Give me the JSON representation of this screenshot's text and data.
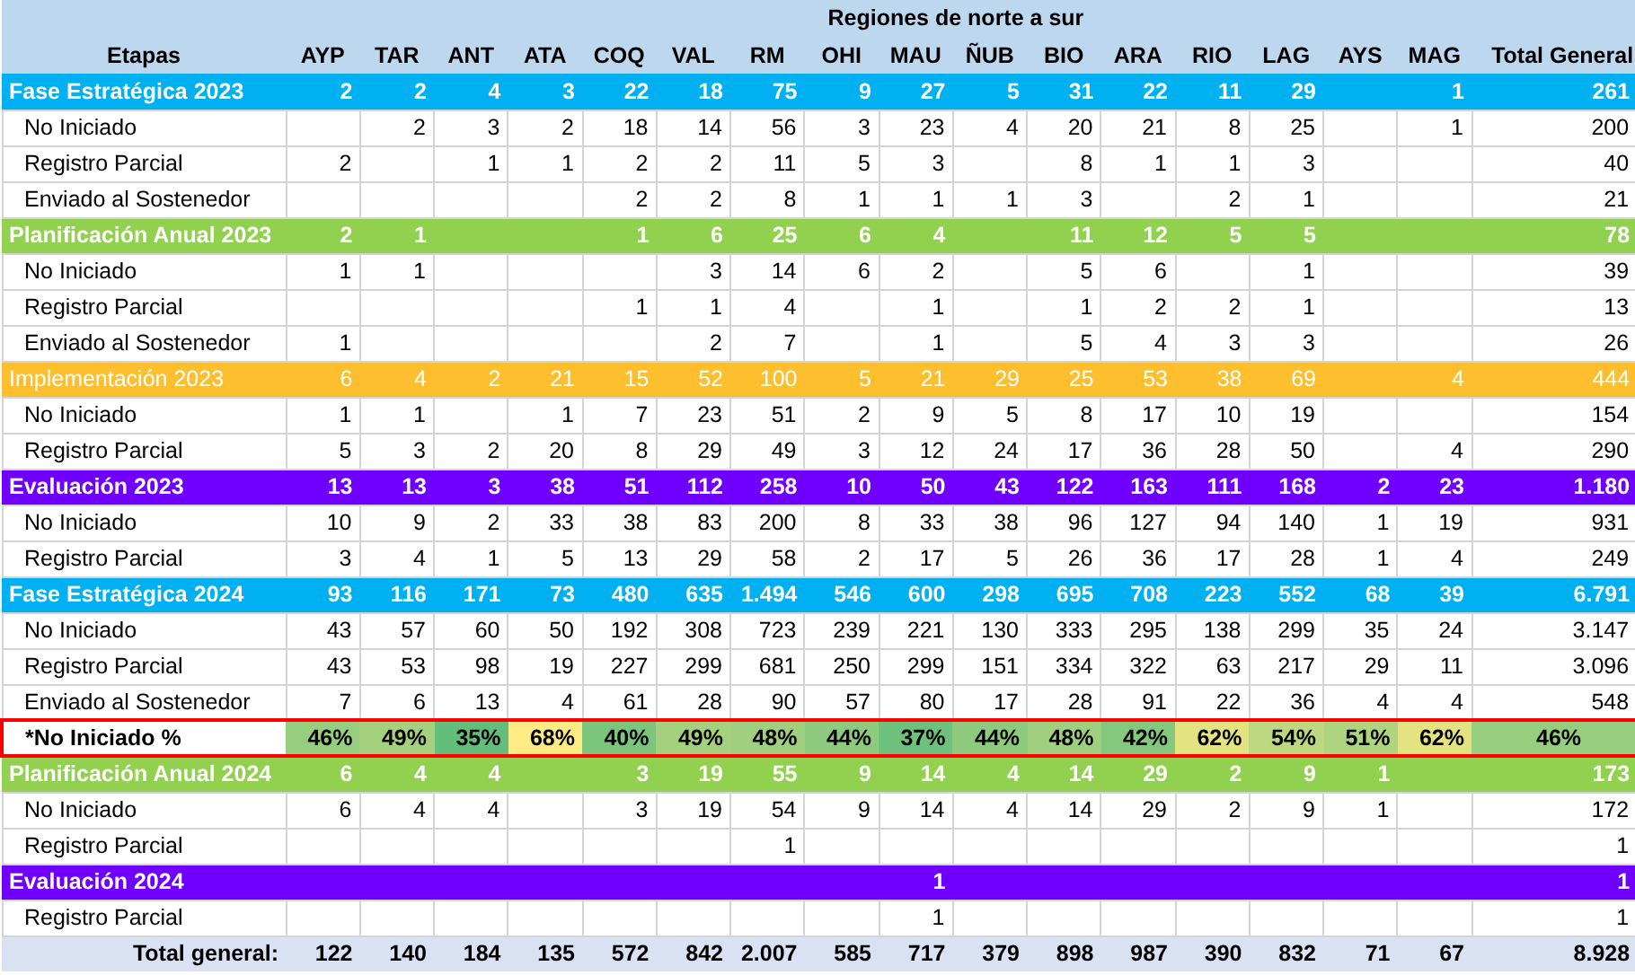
{
  "header": {
    "title": "Regiones de norte a sur",
    "first_column": "Etapas",
    "columns": [
      "AYP",
      "TAR",
      "ANT",
      "ATA",
      "COQ",
      "VAL",
      "RM",
      "OHI",
      "MAU",
      "ÑUB",
      "BIO",
      "ARA",
      "RIO",
      "LAG",
      "AYS",
      "MAG",
      "Total General"
    ]
  },
  "rows": [
    {
      "kind": "group",
      "label": "Fase Estratégica 2023",
      "color": "#00b0f0",
      "bold": true,
      "cells": [
        "2",
        "2",
        "4",
        "3",
        "22",
        "18",
        "75",
        "9",
        "27",
        "5",
        "31",
        "22",
        "11",
        "29",
        null,
        "1",
        "261"
      ]
    },
    {
      "kind": "detail",
      "label": "No Iniciado",
      "cells": [
        null,
        "2",
        "3",
        "2",
        "18",
        "14",
        "56",
        "3",
        "23",
        "4",
        "20",
        "21",
        "8",
        "25",
        null,
        "1",
        "200"
      ]
    },
    {
      "kind": "detail",
      "label": "Registro Parcial",
      "cells": [
        "2",
        null,
        "1",
        "1",
        "2",
        "2",
        "11",
        "5",
        "3",
        null,
        "8",
        "1",
        "1",
        "3",
        null,
        null,
        "40"
      ]
    },
    {
      "kind": "detail",
      "label": "Enviado al Sostenedor",
      "cells": [
        null,
        null,
        null,
        null,
        "2",
        "2",
        "8",
        "1",
        "1",
        "1",
        "3",
        null,
        "2",
        "1",
        null,
        null,
        "21"
      ]
    },
    {
      "kind": "group",
      "label": "Planificación Anual 2023",
      "color": "#92d050",
      "bold": true,
      "cells": [
        "2",
        "1",
        null,
        null,
        "1",
        "6",
        "25",
        "6",
        "4",
        null,
        "11",
        "12",
        "5",
        "5",
        null,
        null,
        "78"
      ]
    },
    {
      "kind": "detail",
      "label": "No Iniciado",
      "cells": [
        "1",
        "1",
        null,
        null,
        null,
        "3",
        "14",
        "6",
        "2",
        null,
        "5",
        "6",
        null,
        "1",
        null,
        null,
        "39"
      ]
    },
    {
      "kind": "detail",
      "label": "Registro Parcial",
      "cells": [
        null,
        null,
        null,
        null,
        "1",
        "1",
        "4",
        null,
        "1",
        null,
        "1",
        "2",
        "2",
        "1",
        null,
        null,
        "13"
      ]
    },
    {
      "kind": "detail",
      "label": "Enviado al Sostenedor",
      "cells": [
        "1",
        null,
        null,
        null,
        null,
        "2",
        "7",
        null,
        "1",
        null,
        "5",
        "4",
        "3",
        "3",
        null,
        null,
        "26"
      ]
    },
    {
      "kind": "group",
      "label": "Implementación 2023",
      "color": "#fdbf2d",
      "bold": false,
      "cells": [
        "6",
        "4",
        "2",
        "21",
        "15",
        "52",
        "100",
        "5",
        "21",
        "29",
        "25",
        "53",
        "38",
        "69",
        null,
        "4",
        "444"
      ]
    },
    {
      "kind": "detail",
      "label": "No Iniciado",
      "cells": [
        "1",
        "1",
        null,
        "1",
        "7",
        "23",
        "51",
        "2",
        "9",
        "5",
        "8",
        "17",
        "10",
        "19",
        null,
        null,
        "154"
      ]
    },
    {
      "kind": "detail",
      "label": "Registro Parcial",
      "cells": [
        "5",
        "3",
        "2",
        "20",
        "8",
        "29",
        "49",
        "3",
        "12",
        "24",
        "17",
        "36",
        "28",
        "50",
        null,
        "4",
        "290"
      ]
    },
    {
      "kind": "group",
      "label": "Evaluación 2023",
      "color": "#6f00ff",
      "bold": true,
      "cells": [
        "13",
        "13",
        "3",
        "38",
        "51",
        "112",
        "258",
        "10",
        "50",
        "43",
        "122",
        "163",
        "111",
        "168",
        "2",
        "23",
        "1.180"
      ]
    },
    {
      "kind": "detail",
      "label": "No Iniciado",
      "cells": [
        "10",
        "9",
        "2",
        "33",
        "38",
        "83",
        "200",
        "8",
        "33",
        "38",
        "96",
        "127",
        "94",
        "140",
        "1",
        "19",
        "931"
      ]
    },
    {
      "kind": "detail",
      "label": "Registro Parcial",
      "cells": [
        "3",
        "4",
        "1",
        "5",
        "13",
        "29",
        "58",
        "2",
        "17",
        "5",
        "26",
        "36",
        "17",
        "28",
        "1",
        "4",
        "249"
      ]
    },
    {
      "kind": "group",
      "label": "Fase Estratégica 2024",
      "color": "#00b0f0",
      "bold": true,
      "cells": [
        "93",
        "116",
        "171",
        "73",
        "480",
        "635",
        "1.494",
        "546",
        "600",
        "298",
        "695",
        "708",
        "223",
        "552",
        "68",
        "39",
        "6.791"
      ]
    },
    {
      "kind": "detail",
      "label": "No Iniciado",
      "cells": [
        "43",
        "57",
        "60",
        "50",
        "192",
        "308",
        "723",
        "239",
        "221",
        "130",
        "333",
        "295",
        "138",
        "299",
        "35",
        "24",
        "3.147"
      ]
    },
    {
      "kind": "detail",
      "label": "Registro Parcial",
      "cells": [
        "43",
        "53",
        "98",
        "19",
        "227",
        "299",
        "681",
        "250",
        "299",
        "151",
        "334",
        "322",
        "63",
        "217",
        "29",
        "11",
        "3.096"
      ]
    },
    {
      "kind": "detail",
      "label": "Enviado al Sostenedor",
      "cells": [
        "7",
        "6",
        "13",
        "4",
        "61",
        "28",
        "90",
        "57",
        "80",
        "17",
        "28",
        "91",
        "22",
        "36",
        "4",
        "4",
        "548"
      ]
    },
    {
      "kind": "percent",
      "label": "*No Iniciado %",
      "cells": [
        {
          "text": "46%",
          "color": "#97cd7e"
        },
        {
          "text": "49%",
          "color": "#a5d17f"
        },
        {
          "text": "35%",
          "color": "#63be7b"
        },
        {
          "text": "68%",
          "color": "#ffeb84"
        },
        {
          "text": "40%",
          "color": "#7bc57c"
        },
        {
          "text": "49%",
          "color": "#a5d17f"
        },
        {
          "text": "48%",
          "color": "#a0d07f"
        },
        {
          "text": "44%",
          "color": "#8eca7d"
        },
        {
          "text": "37%",
          "color": "#6dc17c"
        },
        {
          "text": "44%",
          "color": "#8eca7d"
        },
        {
          "text": "48%",
          "color": "#a0d07f"
        },
        {
          "text": "42%",
          "color": "#84c87d"
        },
        {
          "text": "62%",
          "color": "#e3e382"
        },
        {
          "text": "54%",
          "color": "#bdd880"
        },
        {
          "text": "51%",
          "color": "#afd47f"
        },
        {
          "text": "62%",
          "color": "#e3e382"
        },
        {
          "text": "46%",
          "color": "#97cd7e"
        }
      ]
    },
    {
      "kind": "group",
      "label": "Planificación Anual 2024",
      "color": "#92d050",
      "bold": true,
      "cells": [
        "6",
        "4",
        "4",
        null,
        "3",
        "19",
        "55",
        "9",
        "14",
        "4",
        "14",
        "29",
        "2",
        "9",
        "1",
        null,
        "173"
      ]
    },
    {
      "kind": "detail",
      "label": "No Iniciado",
      "cells": [
        "6",
        "4",
        "4",
        null,
        "3",
        "19",
        "54",
        "9",
        "14",
        "4",
        "14",
        "29",
        "2",
        "9",
        "1",
        null,
        "172"
      ]
    },
    {
      "kind": "detail",
      "label": "Registro Parcial",
      "cells": [
        null,
        null,
        null,
        null,
        null,
        null,
        "1",
        null,
        null,
        null,
        null,
        null,
        null,
        null,
        null,
        null,
        "1"
      ]
    },
    {
      "kind": "group",
      "label": "Evaluación 2024",
      "color": "#6f00ff",
      "bold": true,
      "cells": [
        null,
        null,
        null,
        null,
        null,
        null,
        null,
        null,
        "1",
        null,
        null,
        null,
        null,
        null,
        null,
        null,
        "1"
      ]
    },
    {
      "kind": "detail",
      "label": "Registro Parcial",
      "cells": [
        null,
        null,
        null,
        null,
        null,
        null,
        null,
        null,
        "1",
        null,
        null,
        null,
        null,
        null,
        null,
        null,
        "1"
      ]
    },
    {
      "kind": "total",
      "label": "Total general:",
      "cells": [
        "122",
        "140",
        "184",
        "135",
        "572",
        "842",
        "2.007",
        "585",
        "717",
        "379",
        "898",
        "987",
        "390",
        "832",
        "71",
        "67",
        "8.928"
      ]
    }
  ]
}
